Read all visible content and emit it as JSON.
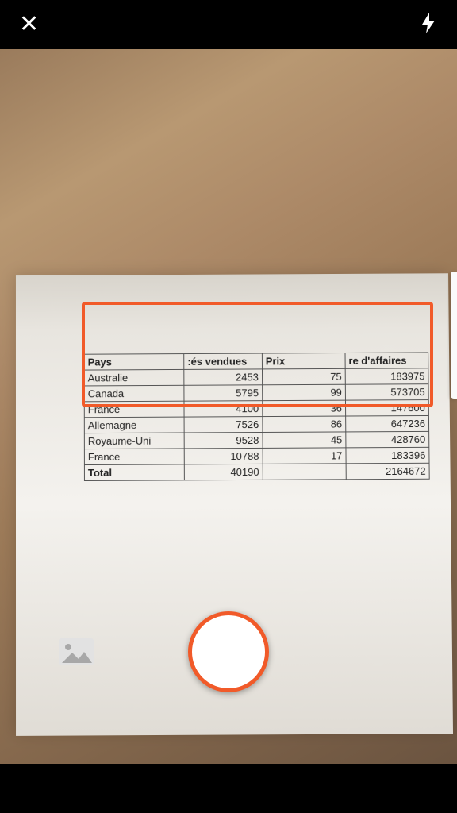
{
  "colors": {
    "accent": "#f15a29",
    "shutter_fill": "#ffffff"
  },
  "table": {
    "headers": {
      "pays": "Pays",
      "qty": ":és vendues",
      "prix": "Prix",
      "rev": "re d'affaires"
    },
    "rows": [
      {
        "pays": "Australie",
        "qty": "2453",
        "prix": "75",
        "rev": "183975"
      },
      {
        "pays": "Canada",
        "qty": "5795",
        "prix": "99",
        "rev": "573705"
      },
      {
        "pays": "France",
        "qty": "4100",
        "prix": "36",
        "rev": "147600"
      },
      {
        "pays": "Allemagne",
        "qty": "7526",
        "prix": "86",
        "rev": "647236"
      },
      {
        "pays": "Royaume-Uni",
        "qty": "9528",
        "prix": "45",
        "rev": "428760"
      },
      {
        "pays": "France",
        "qty": "10788",
        "prix": "17",
        "rev": "183396"
      }
    ],
    "total": {
      "pays": "Total",
      "qty": "40190",
      "prix": "",
      "rev": "2164672"
    }
  }
}
